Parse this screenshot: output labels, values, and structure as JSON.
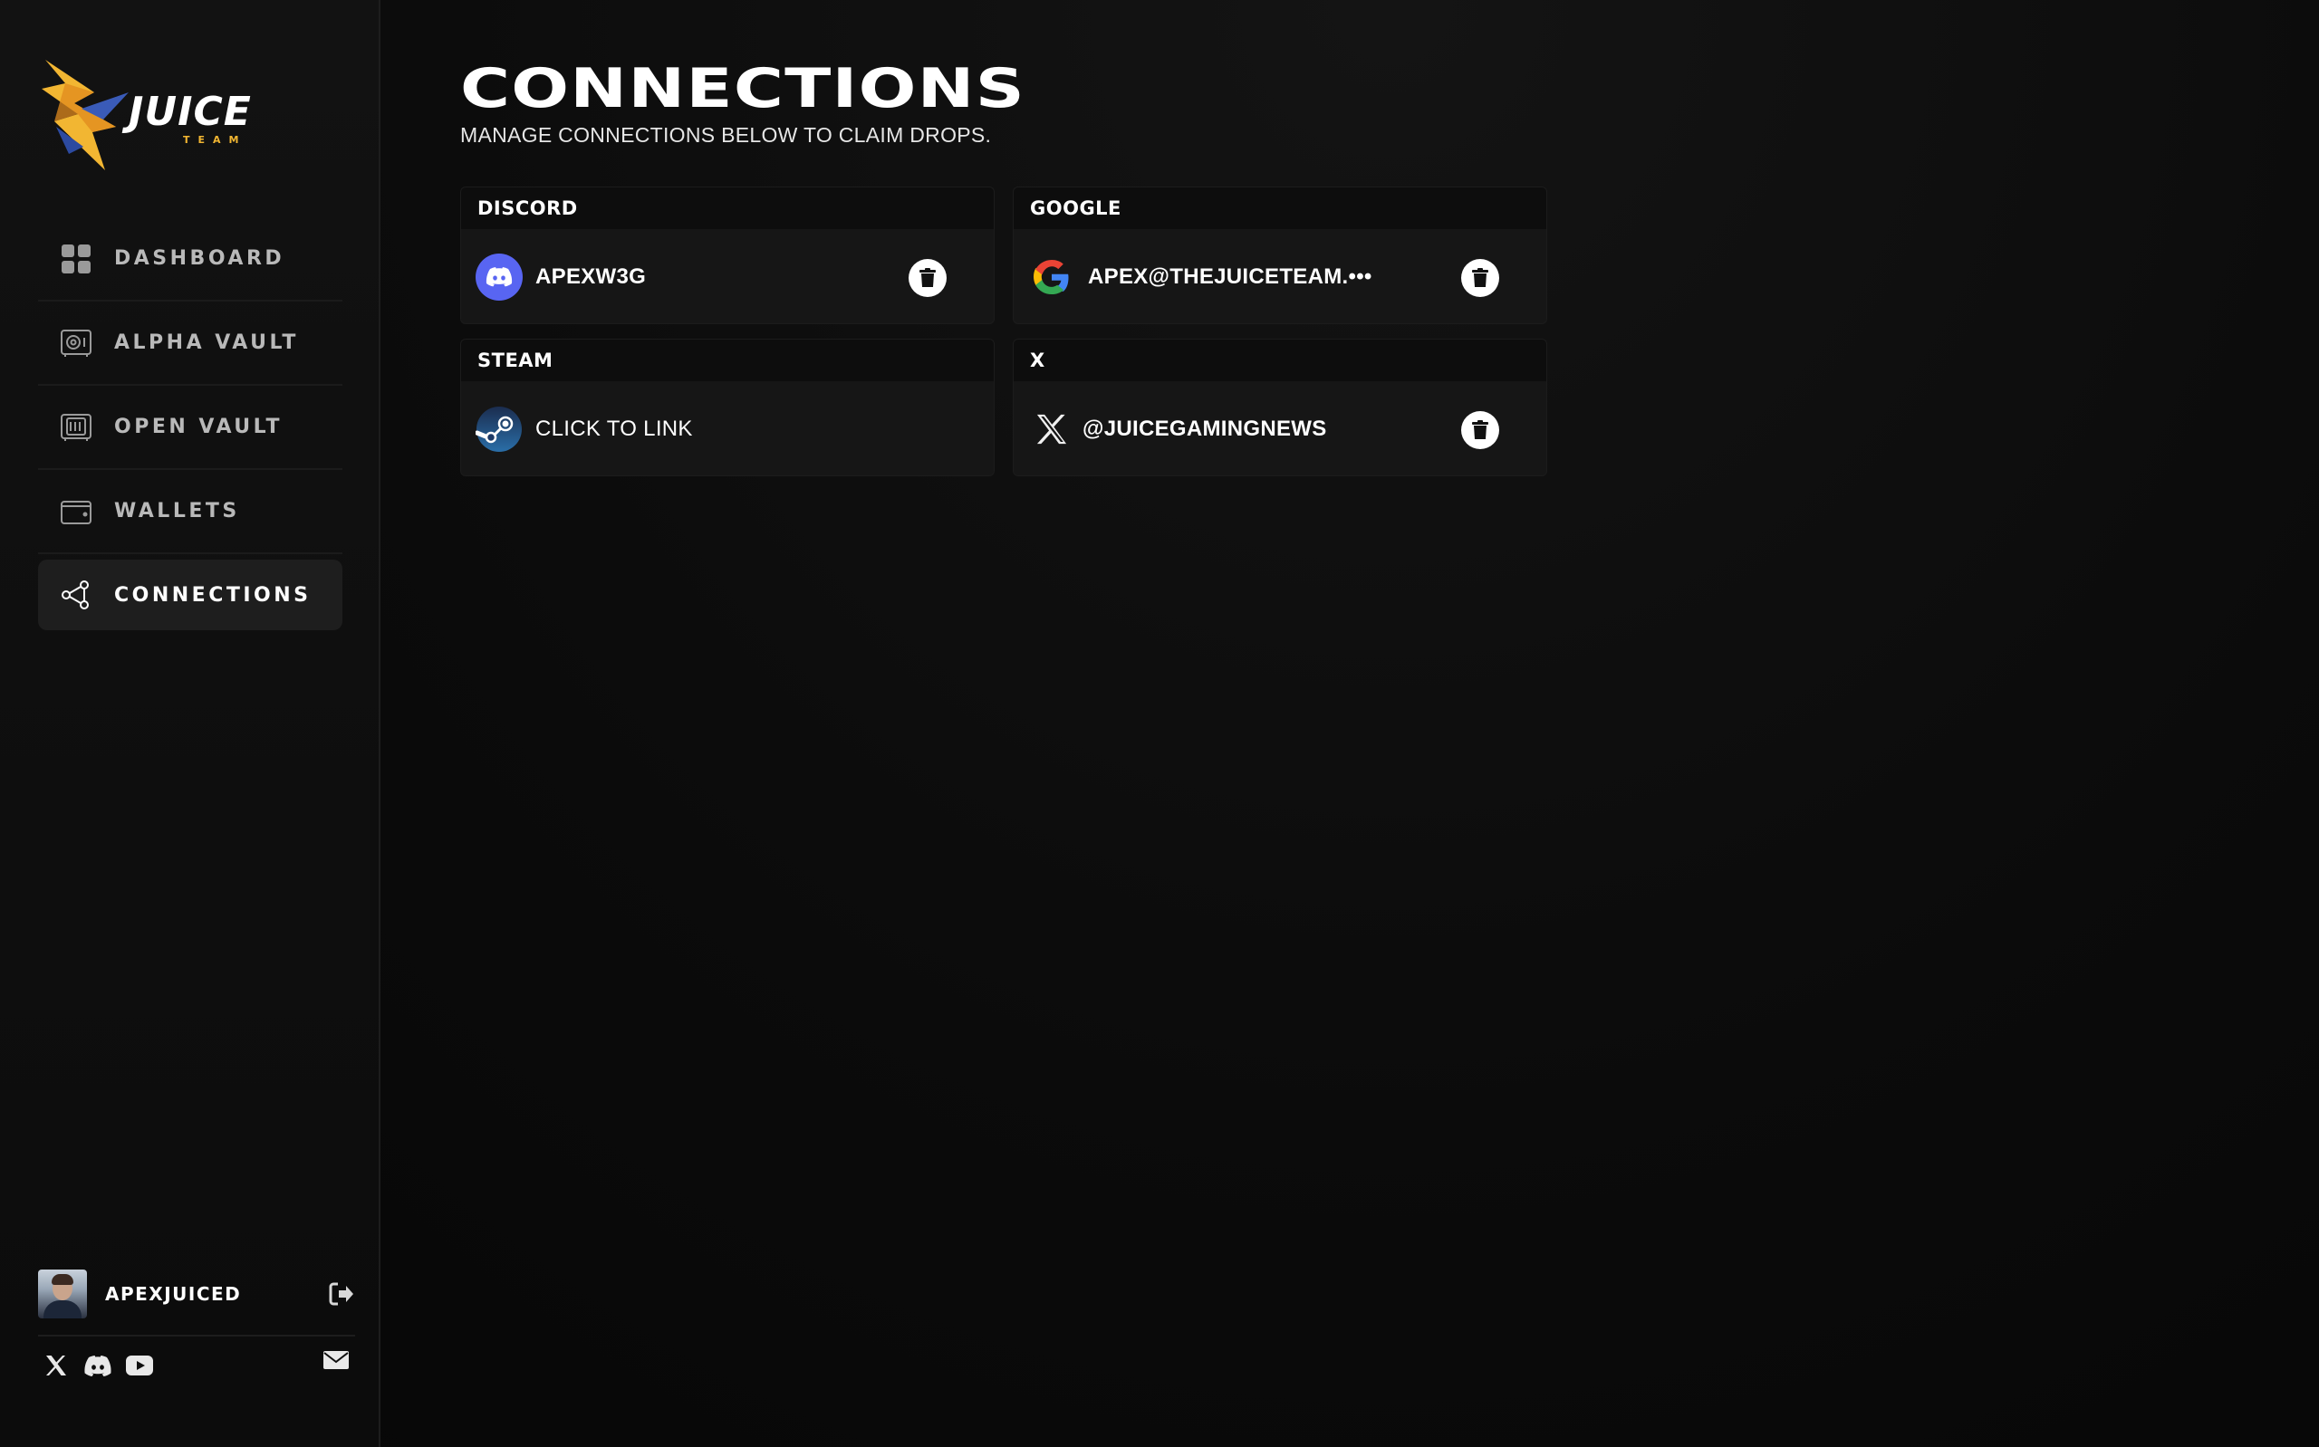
{
  "brand": {
    "name": "JUICE",
    "sub": "TEAM",
    "accent": "#f2b632"
  },
  "nav": {
    "items": [
      {
        "label": "DASHBOARD",
        "icon": "grid-icon"
      },
      {
        "label": "ALPHA VAULT",
        "icon": "safe-icon"
      },
      {
        "label": "OPEN VAULT",
        "icon": "open-safe-icon"
      },
      {
        "label": "WALLETS",
        "icon": "wallet-icon"
      },
      {
        "label": "CONNECTIONS",
        "icon": "share-nodes-icon",
        "active": true
      }
    ]
  },
  "user": {
    "name": "APEXJUICED"
  },
  "page": {
    "title": "CONNECTIONS",
    "subtitle": "MANAGE CONNECTIONS BELOW TO CLAIM DROPS."
  },
  "connections": [
    {
      "service": "DISCORD",
      "account": "APEXW3G",
      "linked": true,
      "icon": "discord-icon",
      "color": "#5865f2"
    },
    {
      "service": "GOOGLE",
      "account": "APEX@THEJUICETEAM.•••",
      "linked": true,
      "icon": "google-icon"
    },
    {
      "service": "STEAM",
      "account": "CLICK TO LINK",
      "linked": false,
      "icon": "steam-icon"
    },
    {
      "service": "X",
      "account": "@JUICEGAMINGNEWS",
      "linked": true,
      "icon": "x-icon"
    }
  ]
}
